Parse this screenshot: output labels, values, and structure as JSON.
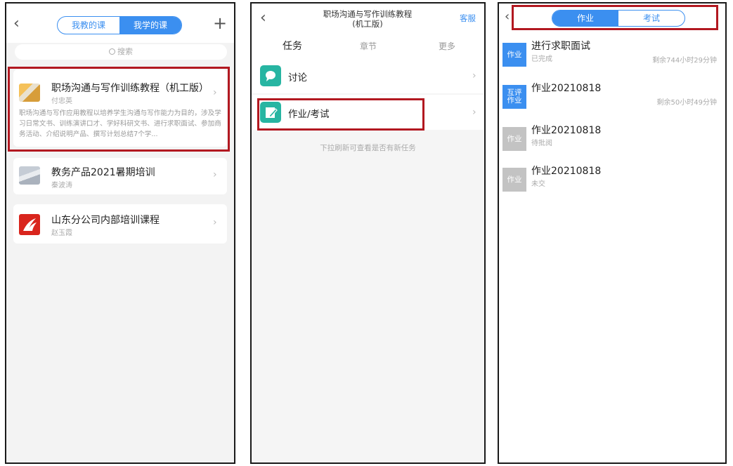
{
  "panel1": {
    "tabs": [
      "我教的课",
      "我学的课"
    ],
    "search_placeholder": "搜索",
    "courses": [
      {
        "title": "职场沟通与写作训练教程（机工版）",
        "teacher": "付忠英",
        "desc": "职场沟通与写作应用教程以培养学生沟通与写作能力为目的，涉及学习日常文书、训练演讲口才、学好科研文书、进行求职面试、参加商务活动、介绍说明产品、撰写计划总结7个学..."
      },
      {
        "title": "教务产品2021暑期培训",
        "teacher": "秦波涛"
      },
      {
        "title": "山东分公司内部培训课程",
        "teacher": "赵玉霞"
      }
    ]
  },
  "panel2": {
    "title_line1": "职场沟通与写作训练教程",
    "title_line2": "(机工版)",
    "service": "客服",
    "tabs": [
      "任务",
      "章节",
      "更多"
    ],
    "items": [
      "讨论",
      "作业/考试"
    ],
    "hint": "下拉刷新可查看是否有新任务"
  },
  "panel3": {
    "tabs": [
      "作业",
      "考试"
    ],
    "items": [
      {
        "badge": "作业",
        "title": "进行求职面试",
        "status": "已完成",
        "remain": "剩余744小时29分钟"
      },
      {
        "badge_l1": "互评",
        "badge_l2": "作业",
        "title": "作业20210818",
        "status": "",
        "remain": "剩余50小时49分钟"
      },
      {
        "badge": "作业",
        "title": "作业20210818",
        "status": "待批阅",
        "remain": ""
      },
      {
        "badge": "作业",
        "title": "作业20210818",
        "status": "未交",
        "remain": ""
      }
    ]
  },
  "colors": {
    "accent": "#3b8ff0",
    "highlight": "#b21820",
    "teal": "#27b5a2"
  }
}
